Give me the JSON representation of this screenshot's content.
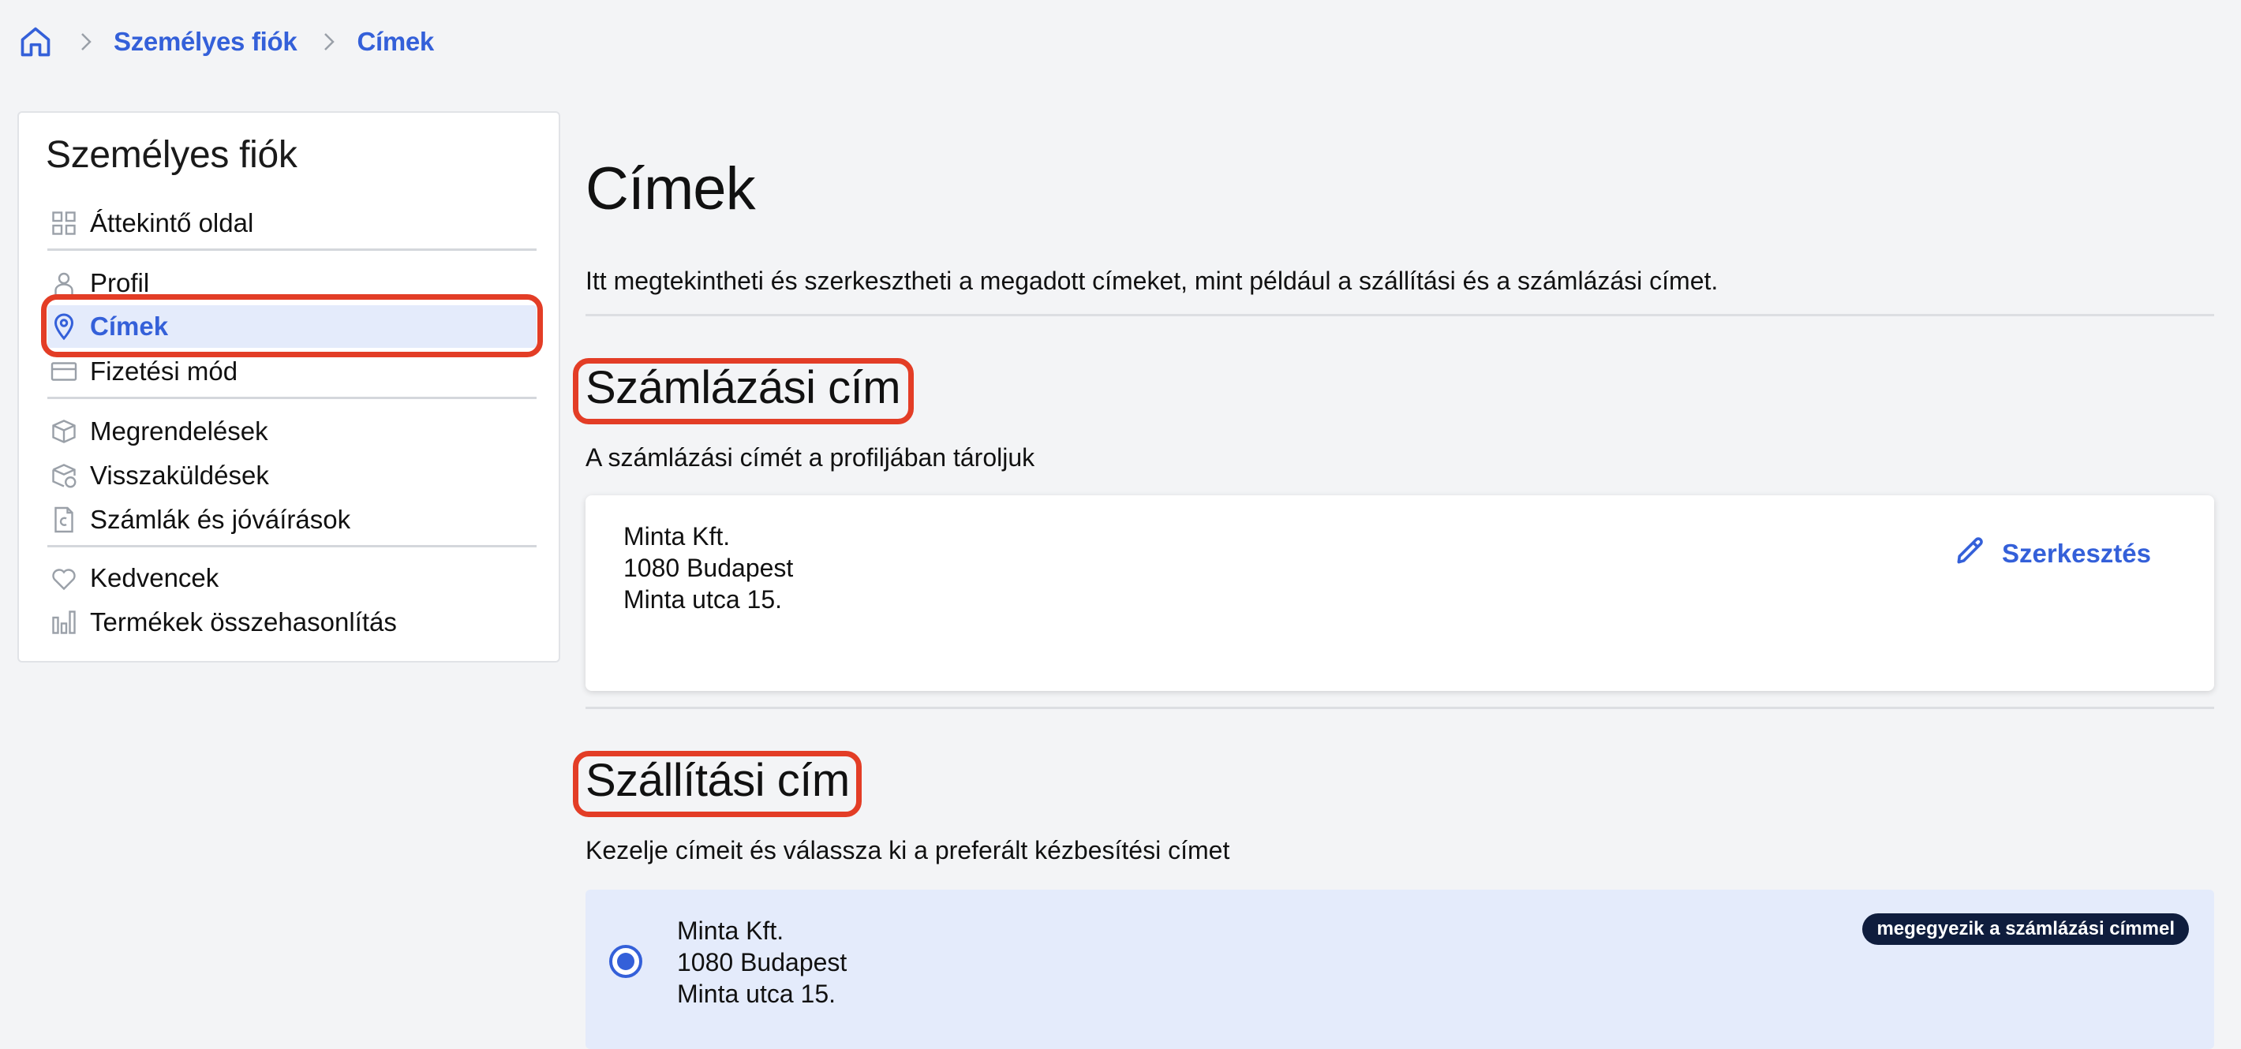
{
  "breadcrumb": {
    "items": [
      {
        "label": "Személyes fiók"
      },
      {
        "label": "Címek"
      }
    ]
  },
  "sidebar": {
    "title": "Személyes fiók",
    "items": [
      {
        "label": "Áttekintő oldal",
        "icon": "grid-icon"
      },
      {
        "label": "Profil",
        "icon": "person-icon"
      },
      {
        "label": "Címek",
        "icon": "location-pin-icon",
        "active": true
      },
      {
        "label": "Fizetési mód",
        "icon": "credit-card-icon"
      },
      {
        "label": "Megrendelések",
        "icon": "package-icon"
      },
      {
        "label": "Visszaküldések",
        "icon": "return-package-icon"
      },
      {
        "label": "Számlák és jóváírások",
        "icon": "invoice-icon"
      },
      {
        "label": "Kedvencek",
        "icon": "heart-icon"
      },
      {
        "label": "Termékek összehasonlítás",
        "icon": "bar-chart-icon"
      }
    ]
  },
  "main": {
    "title": "Címek",
    "intro": "Itt megtekintheti és szerkesztheti a megadott címeket, mint például a szállítási és a számlázási címet.",
    "billing": {
      "title": "Számlázási cím",
      "description": "A számlázási címét a profiljában tároljuk",
      "address": {
        "line1": "Minta Kft.",
        "line2": "1080 Budapest",
        "line3": "Minta utca 15."
      },
      "edit_label": "Szerkesztés"
    },
    "shipping": {
      "title": "Szállítási cím",
      "description": "Kezelje címeit és válassza ki a preferált kézbesítési címet",
      "address": {
        "line1": "Minta Kft.",
        "line2": "1080 Budapest",
        "line3": "Minta utca 15."
      },
      "badge": "megegyezik a számlázási címmel",
      "selected": true
    }
  },
  "colors": {
    "accent": "#3460d9",
    "highlight": "#e33d26",
    "active_bg": "#e4ebfb",
    "badge_bg": "#0f1d3d"
  }
}
